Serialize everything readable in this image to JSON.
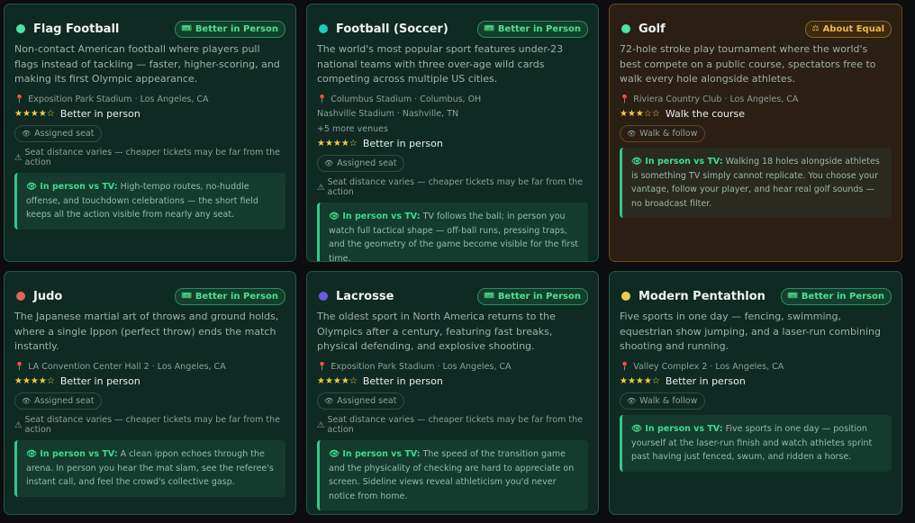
{
  "cards": [
    {
      "title": "Flag Football",
      "dot": "#4fe0a8",
      "badge": "Better in Person",
      "desc": "Non-contact American football where players pull flags instead of tackling — faster, higher-scoring, and making its first Olympic appearance.",
      "venues": [
        "Exposition Park Stadium · Los Angeles, CA"
      ],
      "more": "",
      "stars": "★★★★☆",
      "rating": "Better in person",
      "chip": "Assigned seat",
      "warning": "Seat distance varies — cheaper tickets may be far from the action",
      "tv_label": "In person vs TV:",
      "tv_text": "High-tempo routes, no-huddle offense, and touchdown celebrations — the short field keeps all the action visible from nearly any seat."
    },
    {
      "title": "Football (Soccer)",
      "dot": "#22c9c0",
      "badge": "Better in Person",
      "desc": "The world's most popular sport features under-23 national teams with three over-age wild cards competing across multiple US cities.",
      "venues": [
        "Columbus Stadium · Columbus, OH",
        "Nashville Stadium · Nashville, TN"
      ],
      "more": "+5 more venues",
      "stars": "★★★★☆",
      "rating": "Better in person",
      "chip": "Assigned seat",
      "warning": "Seat distance varies — cheaper tickets may be far from the action",
      "tv_label": "In person vs TV:",
      "tv_text": "TV follows the ball; in person you watch full tactical shape — off-ball runs, pressing traps, and the geometry of the game become visible for the first time."
    },
    {
      "title": "Golf",
      "dot": "#4fe0a8",
      "badge": "About Equal",
      "amber": true,
      "desc": "72-hole stroke play tournament where the world's best compete on a public course, spectators free to walk every hole alongside athletes.",
      "venues": [
        "Riviera Country Club · Los Angeles, CA"
      ],
      "more": "",
      "stars": "★★★☆☆",
      "rating": "Walk the course",
      "chip": "Walk & follow",
      "warning": "",
      "tv_label": "In person vs TV:",
      "tv_text": "Walking 18 holes alongside athletes is something TV simply cannot replicate. You choose your vantage, follow your player, and hear real golf sounds — no broadcast filter."
    },
    {
      "title": "Judo",
      "dot": "#e0655a",
      "badge": "Better in Person",
      "desc": "The Japanese martial art of throws and ground holds, where a single Ippon (perfect throw) ends the match instantly.",
      "venues": [
        "LA Convention Center Hall 2 · Los Angeles, CA"
      ],
      "more": "",
      "stars": "★★★★☆",
      "rating": "Better in person",
      "chip": "Assigned seat",
      "warning": "Seat distance varies — cheaper tickets may be far from the action",
      "tv_label": "In person vs TV:",
      "tv_text": "A clean ippon echoes through the arena. In person you hear the mat slam, see the referee's instant call, and feel the crowd's collective gasp."
    },
    {
      "title": "Lacrosse",
      "dot": "#6a5ae0",
      "badge": "Better in Person",
      "desc": "The oldest sport in North America returns to the Olympics after a century, featuring fast breaks, physical defending, and explosive shooting.",
      "venues": [
        "Exposition Park Stadium · Los Angeles, CA"
      ],
      "more": "",
      "stars": "★★★★☆",
      "rating": "Better in person",
      "chip": "Assigned seat",
      "warning": "Seat distance varies — cheaper tickets may be far from the action",
      "tv_label": "In person vs TV:",
      "tv_text": "The speed of the transition game and the physicality of checking are hard to appreciate on screen. Sideline views reveal athleticism you'd never notice from home."
    },
    {
      "title": "Modern Pentathlon",
      "dot": "#f2c94c",
      "badge": "Better in Person",
      "desc": "Five sports in one day — fencing, swimming, equestrian show jumping, and a laser-run combining shooting and running.",
      "venues": [
        "Valley Complex 2 · Los Angeles, CA"
      ],
      "more": "",
      "stars": "★★★★☆",
      "rating": "Better in person",
      "chip": "Walk & follow",
      "warning": "",
      "tv_label": "In person vs TV:",
      "tv_text": "Five sports in one day — position yourself at the laser-run finish and watch athletes sprint past having just fenced, swum, and ridden a horse."
    }
  ],
  "colors": {
    "accent": "#3ddc8e",
    "amber": "#f2b441",
    "card_bg": "#0f2a22"
  },
  "icons": {
    "badge": "ticket-icon",
    "pin": "pin-icon",
    "eye": "eye-icon",
    "warning": "warning-icon",
    "badge_amber": "scale-icon"
  }
}
